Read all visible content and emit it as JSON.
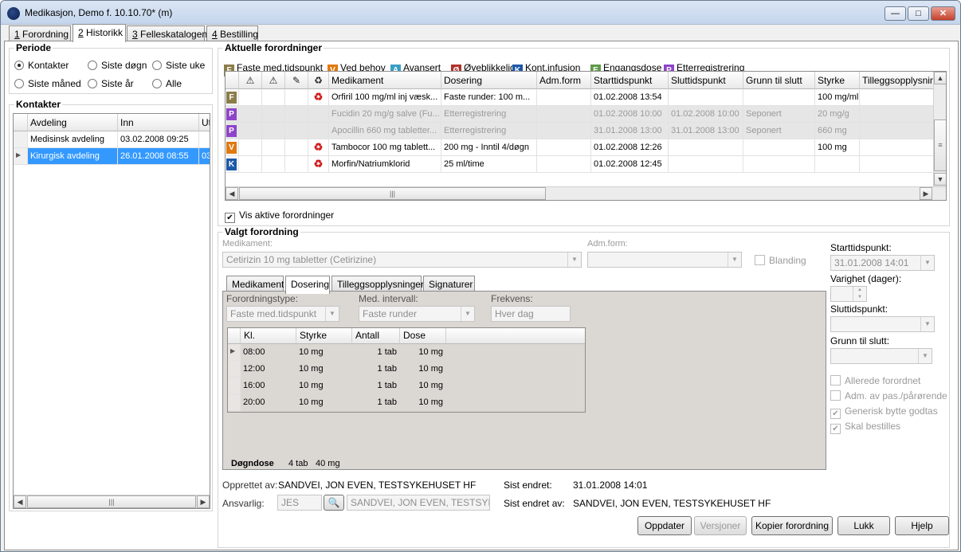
{
  "window": {
    "title": "Medikasjon, Demo f. 10.10.70* (m)",
    "min_label": "—",
    "max_label": "□",
    "close_label": "✕"
  },
  "main_tabs": [
    {
      "num": "1",
      "label": " Forordning"
    },
    {
      "num": "2",
      "label": " Historikk"
    },
    {
      "num": "3",
      "label": " Felleskatalogen"
    },
    {
      "num": "4",
      "label": " Bestilling"
    }
  ],
  "periode": {
    "title": "Periode",
    "options": [
      "Kontakter",
      "Siste døgn",
      "Siste uke",
      "Siste måned",
      "Siste år",
      "Alle"
    ],
    "selected": "Kontakter"
  },
  "kontakter": {
    "title": "Kontakter",
    "columns": [
      "Avdeling",
      "Inn",
      "Ut"
    ],
    "rows": [
      {
        "avdeling": "Medisinsk avdeling",
        "inn": "03.02.2008 09:25",
        "ut": ""
      },
      {
        "avdeling": "Kirurgisk avdeling",
        "inn": "26.01.2008 08:55",
        "ut": "03"
      }
    ],
    "selected_index": 1
  },
  "aktuelle": {
    "title": "Aktuelle forordninger",
    "legend": [
      {
        "code": "F",
        "label": "Faste med.tidspunkt",
        "color": "#8b7d4a"
      },
      {
        "code": "V",
        "label": "Ved behov",
        "color": "#e07a10"
      },
      {
        "code": "A",
        "label": "Avansert",
        "color": "#3b9fc4"
      },
      {
        "code": "Ø",
        "label": "Øyeblikkelig",
        "color": "#b0302a"
      },
      {
        "code": "K",
        "label": "Kont.infusjon",
        "color": "#1d58a8"
      },
      {
        "code": "E",
        "label": "Engangsdose",
        "color": "#5f9a4a"
      },
      {
        "code": "P",
        "label": "Etterregistrering",
        "color": "#8e44c8"
      }
    ],
    "columns": [
      "Medikament",
      "Dosering",
      "Adm.form",
      "Starttidspunkt",
      "Sluttidspunkt",
      "Grunn til slutt",
      "Styrke",
      "Tilleggsopplysninger"
    ],
    "header_icons": [
      "warning-triangle-icon",
      "warning-triangle-icon",
      "syringe-icon",
      "recycle-icon"
    ],
    "rows": [
      {
        "type": "F",
        "recycle": true,
        "medikament": "Orfiril 100 mg/ml inj væsk...",
        "dosering": "Faste runder: 100 m...",
        "adm": "",
        "start": "01.02.2008 13:54",
        "slutt": "",
        "grunn": "",
        "styrke": "100 mg/ml",
        "tillegg": "",
        "inactive": false
      },
      {
        "type": "P",
        "recycle": false,
        "medikament": "Fucidin 20 mg/g salve (Fu...",
        "dosering": "Etterregistrering",
        "adm": "",
        "start": "01.02.2008 10:00",
        "slutt": "01.02.2008 10:00",
        "grunn": "Seponert",
        "styrke": "20 mg/g",
        "tillegg": "",
        "inactive": true
      },
      {
        "type": "P",
        "recycle": false,
        "medikament": "Apocillin 660 mg tabletter...",
        "dosering": "Etterregistrering",
        "adm": "",
        "start": "31.01.2008 13:00",
        "slutt": "31.01.2008 13:00",
        "grunn": "Seponert",
        "styrke": "660 mg",
        "tillegg": "",
        "inactive": true
      },
      {
        "type": "V",
        "recycle": true,
        "medikament": "Tambocor 100 mg tablett...",
        "dosering": "200 mg - Inntil 4/døgn",
        "adm": "",
        "start": "01.02.2008 12:26",
        "slutt": "",
        "grunn": "",
        "styrke": "100 mg",
        "tillegg": "",
        "inactive": false
      },
      {
        "type": "K",
        "recycle": true,
        "medikament": "Morfin/Natriumklorid",
        "dosering": "25 ml/time",
        "adm": "",
        "start": "01.02.2008 12:45",
        "slutt": "",
        "grunn": "",
        "styrke": "",
        "tillegg": "",
        "inactive": false
      }
    ],
    "vis_aktive_label": "Vis aktive forordninger",
    "vis_aktive_checked": true
  },
  "valgt": {
    "title": "Valgt forordning",
    "medikament_label": "Medikament:",
    "medikament_value": "Cetirizin 10 mg tabletter (Cetirizine)",
    "admform_label": "Adm.form:",
    "admform_value": "",
    "blanding_label": "Blanding",
    "tabs": [
      "Medikament",
      "Dosering",
      "Tilleggsopplysninger",
      "Signaturer"
    ],
    "active_tab": "Dosering",
    "forordningstype_label": "Forordningstype:",
    "forordningstype_value": "Faste med.tidspunkt",
    "intervall_label": "Med. intervall:",
    "intervall_value": "Faste runder",
    "frekvens_label": "Frekvens:",
    "frekvens_value": "Hver dag",
    "dose_columns": [
      "Kl.",
      "Styrke",
      "Antall",
      "Dose"
    ],
    "dose_rows": [
      {
        "kl": "08:00",
        "styrke": "10 mg",
        "antall": "1 tab",
        "dose": "10 mg"
      },
      {
        "kl": "12:00",
        "styrke": "10 mg",
        "antall": "1 tab",
        "dose": "10 mg"
      },
      {
        "kl": "16:00",
        "styrke": "10 mg",
        "antall": "1 tab",
        "dose": "10 mg"
      },
      {
        "kl": "20:00",
        "styrke": "10 mg",
        "antall": "1 tab",
        "dose": "10 mg"
      }
    ],
    "dogndose_label": "Døgndose",
    "dogndose_antall": "4 tab",
    "dogndose_mengde": "40 mg",
    "starttidspunkt_label": "Starttidspunkt:",
    "starttidspunkt_value": "31.01.2008 14:01",
    "varighet_label": "Varighet (dager):",
    "sluttidspunkt_label": "Sluttidspunkt:",
    "grunn_label": "Grunn til slutt:",
    "checks": [
      {
        "label": "Allerede forordnet",
        "checked": false
      },
      {
        "label": "Adm. av pas./pårørende",
        "checked": false
      },
      {
        "label": "Generisk bytte godtas",
        "checked": true
      },
      {
        "label": "Skal bestilles",
        "checked": true
      }
    ],
    "opprettet_label": "Opprettet av:",
    "opprettet_value": "SANDVEI, JON EVEN, TESTSYKEHUSET HF",
    "sist_endret_label": "Sist endret:",
    "sist_endret_value": "31.01.2008 14:01",
    "ansvarlig_label": "Ansvarlig:",
    "ansvarlig_code": "JES",
    "ansvarlig_name": "SANDVEI, JON EVEN, TESTSYKEH",
    "sist_endret_av_label": "Sist endret av:",
    "sist_endret_av_value": "SANDVEI, JON EVEN, TESTSYKEHUSET HF"
  },
  "buttons": {
    "oppdater": "Oppdater",
    "versjoner": "Versjoner",
    "kopier": "Kopier forordning",
    "lukk": "Lukk",
    "hjelp": "Hjelp"
  }
}
